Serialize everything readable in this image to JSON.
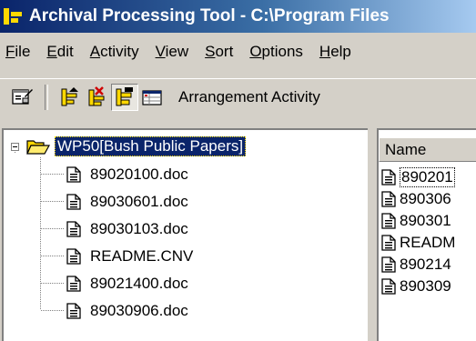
{
  "window": {
    "title": "Archival Processing Tool - C:\\Program Files"
  },
  "menu": [
    "File",
    "Edit",
    "Activity",
    "View",
    "Sort",
    "Options",
    "Help"
  ],
  "toolbar": {
    "label": "Arrangement Activity",
    "buttons": [
      "properties-icon",
      "arrange-up-icon",
      "arrange-down-icon",
      "arrange-select-icon",
      "details-grid-icon"
    ]
  },
  "tree": {
    "root": "WP50[Bush Public Papers]",
    "items": [
      "89020100.doc",
      "89030601.doc",
      "89030103.doc",
      "README.CNV",
      "89021400.doc",
      "89030906.doc"
    ]
  },
  "list": {
    "header": "Name",
    "rows": [
      "890201",
      "890306",
      "890301",
      "READM",
      "890214",
      "890309"
    ]
  },
  "colors": {
    "title_start": "#0a246a",
    "title_end": "#a6caf0",
    "selection": "#0a246a",
    "window_bg": "#d4d0c8"
  }
}
